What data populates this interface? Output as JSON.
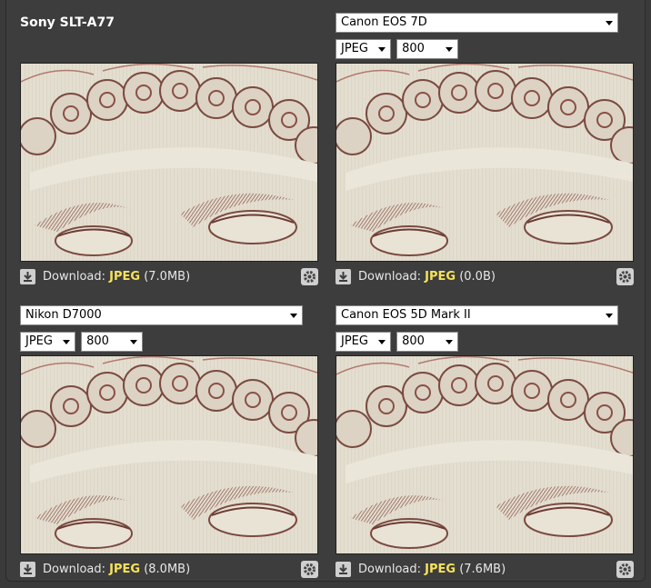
{
  "panels": [
    {
      "title": "Sony SLT-A77",
      "download_label": "Download:",
      "format": "JPEG",
      "size": "(7.0MB)"
    },
    {
      "camera": "Canon EOS 7D",
      "format_option": "JPEG",
      "iso_option": "800",
      "download_label": "Download:",
      "format": "JPEG",
      "size": "(0.0B)"
    },
    {
      "camera": "Nikon D7000",
      "format_option": "JPEG",
      "iso_option": "800",
      "download_label": "Download:",
      "format": "JPEG",
      "size": "(8.0MB)"
    },
    {
      "camera": "Canon EOS 5D Mark II",
      "format_option": "JPEG",
      "iso_option": "800",
      "download_label": "Download:",
      "format": "JPEG",
      "size": "(7.6MB)"
    }
  ],
  "icons": {
    "download": "download-icon",
    "settings": "gear-icon",
    "dropdown": "chevron-down-icon"
  },
  "colors": {
    "background": "#3d3d3d",
    "format_highlight": "#f5e25a"
  }
}
